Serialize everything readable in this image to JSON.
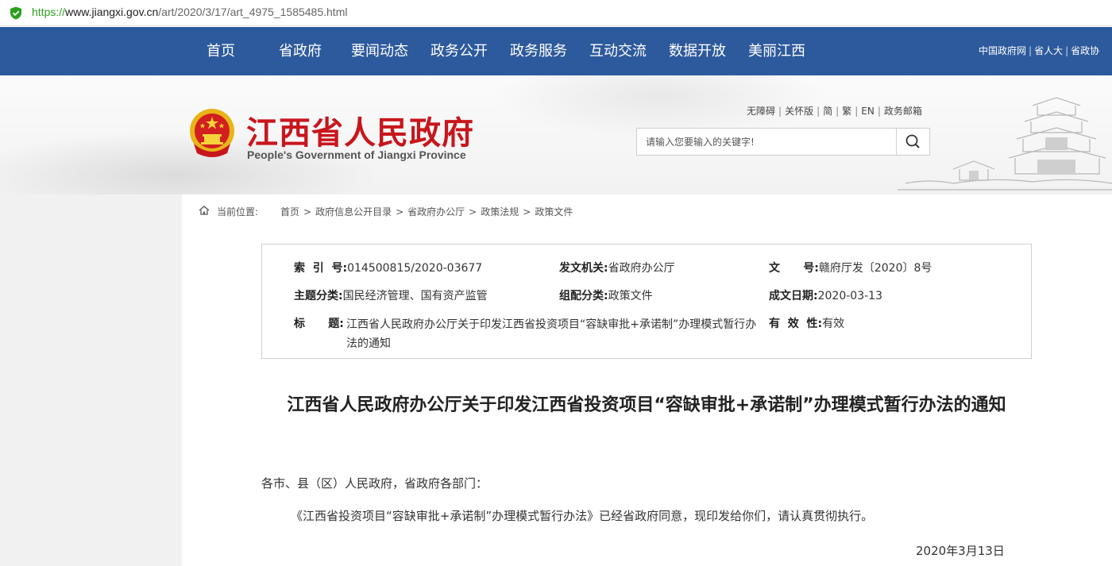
{
  "browser": {
    "url_scheme": "https://",
    "url_host": "www.jiangxi.gov.cn",
    "url_path": "/art/2020/3/17/art_4975_1585485.html"
  },
  "nav": {
    "items": [
      "首页",
      "省政府",
      "要闻动态",
      "政务公开",
      "政务服务",
      "互动交流",
      "数据开放",
      "美丽江西"
    ],
    "links": [
      "中国政府网",
      "省人大",
      "省政协"
    ]
  },
  "header": {
    "site_title": "江西省人民政府",
    "site_subtitle": "People's Government of Jiangxi Province",
    "tools": [
      "无障碍",
      "关怀版",
      "简",
      "繁",
      "EN",
      "政务邮箱"
    ],
    "search_placeholder": "请输入您要输入的关键字!"
  },
  "breadcrumb": {
    "label": "当前位置:",
    "items": [
      "首页",
      "政府信息公开目录",
      "省政府办公厅",
      "政策法规",
      "政策文件"
    ]
  },
  "meta": {
    "index_label": "索  引  号:",
    "index_value": "014500815/2020-03677",
    "issuer_label": "发文机关:",
    "issuer_value": "省政府办公厅",
    "docno_label": "文      号:",
    "docno_value": "赣府厅发〔2020〕8号",
    "topic_label": "主题分类:",
    "topic_value": "国民经济管理、国有资产监管",
    "group_label": "组配分类:",
    "group_value": "政策文件",
    "date_label": "成文日期:",
    "date_value": "2020-03-13",
    "title_label": "标      题:",
    "title_value": "江西省人民政府办公厅关于印发江西省投资项目“容缺审批+承诺制”办理模式暂行办法的通知",
    "valid_label": "有  效  性:",
    "valid_value": "有效"
  },
  "document": {
    "title": "江西省人民政府办公厅关于印发江西省投资项目“容缺审批+承诺制”办理模式暂行办法的通知",
    "salutation": "各市、县（区）人民政府，省政府各部门：",
    "paragraph": "《江西省投资项目“容缺审批+承诺制”办理模式暂行办法》已经省政府同意，现印发给你们，请认真贯彻执行。",
    "date": "2020年3月13日"
  },
  "colors": {
    "nav_bg": "#2d5a9c",
    "title_red": "#c8161d",
    "secure_green": "#2ca01c"
  }
}
